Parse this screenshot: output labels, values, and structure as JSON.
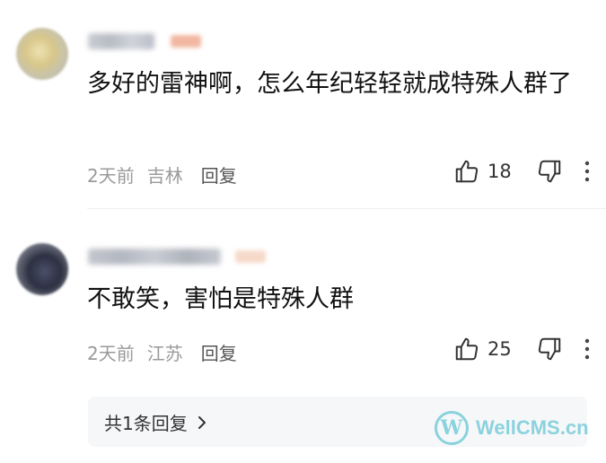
{
  "comments": [
    {
      "text": "多好的雷神啊，怎么年纪轻轻就成特殊人群了",
      "time": "2天前",
      "location": "吉林",
      "reply_label": "回复",
      "likes": "18"
    },
    {
      "text": "不敢笑，害怕是特殊人群",
      "time": "2天前",
      "location": "江苏",
      "reply_label": "回复",
      "likes": "25"
    }
  ],
  "replies": {
    "label": "共1条回复"
  },
  "watermark": {
    "logo_letter": "W",
    "text": "WellCMS.cn"
  },
  "icons": {
    "like": "thumbs-up-icon",
    "dislike": "thumbs-down-icon",
    "more": "more-vertical-icon",
    "chevron": "chevron-right-icon"
  },
  "colors": {
    "watermark": "#33b5c8",
    "meta_text": "#9a9a9a"
  }
}
